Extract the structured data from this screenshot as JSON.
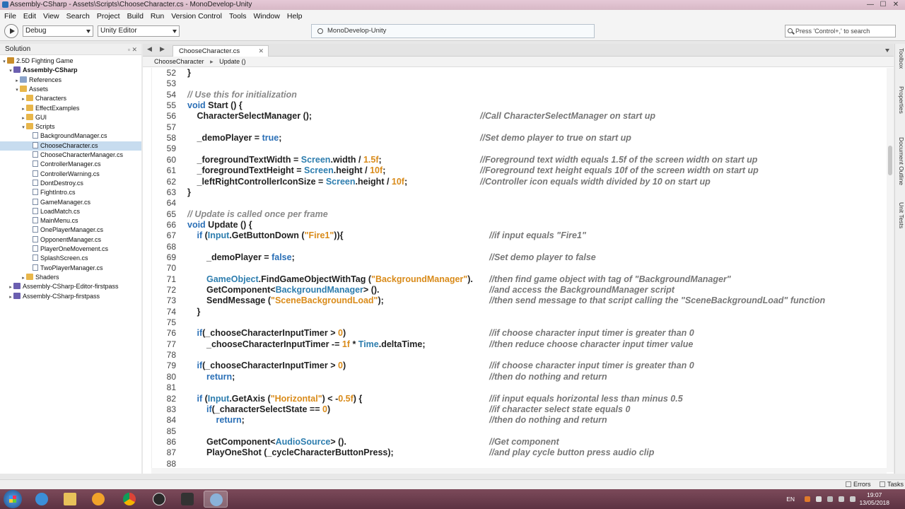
{
  "window": {
    "title": "Assembly-CSharp - Assets\\Scripts\\ChooseCharacter.cs - MonoDevelop-Unity",
    "controls": {
      "minimize": "—",
      "maximize": "☐",
      "close": "✕"
    }
  },
  "menu": [
    "File",
    "Edit",
    "View",
    "Search",
    "Project",
    "Build",
    "Run",
    "Version Control",
    "Tools",
    "Window",
    "Help"
  ],
  "toolbar": {
    "configuration": "Debug",
    "target": "Unity Editor",
    "status": "MonoDevelop-Unity",
    "search_placeholder": "Press 'Control+,' to search"
  },
  "solution_pad": {
    "title": "Solution",
    "buttons": "▫ ✕",
    "items": [
      {
        "label": "2.5D Fighting Game",
        "depth": 0,
        "icon": "sol",
        "arrow": "▾",
        "bold": false
      },
      {
        "label": "Assembly-CSharp",
        "depth": 1,
        "icon": "proj",
        "arrow": "▾",
        "bold": true
      },
      {
        "label": "References",
        "depth": 2,
        "icon": "refs",
        "arrow": "▸",
        "bold": false
      },
      {
        "label": "Assets",
        "depth": 2,
        "icon": "folder",
        "arrow": "▾",
        "bold": false
      },
      {
        "label": "Characters",
        "depth": 3,
        "icon": "folder",
        "arrow": "▸",
        "bold": false
      },
      {
        "label": "EffectExamples",
        "depth": 3,
        "icon": "folder",
        "arrow": "▸",
        "bold": false
      },
      {
        "label": "GUI",
        "depth": 3,
        "icon": "folder",
        "arrow": "▸",
        "bold": false
      },
      {
        "label": "Scripts",
        "depth": 3,
        "icon": "folder",
        "arrow": "▾",
        "bold": false
      },
      {
        "label": "BackgroundManager.cs",
        "depth": 4,
        "icon": "file",
        "arrow": "",
        "bold": false
      },
      {
        "label": "ChooseCharacter.cs",
        "depth": 4,
        "icon": "file",
        "arrow": "",
        "bold": false,
        "selected": true
      },
      {
        "label": "ChooseCharacterManager.cs",
        "depth": 4,
        "icon": "file",
        "arrow": "",
        "bold": false
      },
      {
        "label": "ControllerManager.cs",
        "depth": 4,
        "icon": "file",
        "arrow": "",
        "bold": false
      },
      {
        "label": "ControllerWarning.cs",
        "depth": 4,
        "icon": "file",
        "arrow": "",
        "bold": false
      },
      {
        "label": "DontDestroy.cs",
        "depth": 4,
        "icon": "file",
        "arrow": "",
        "bold": false
      },
      {
        "label": "FightIntro.cs",
        "depth": 4,
        "icon": "file",
        "arrow": "",
        "bold": false
      },
      {
        "label": "GameManager.cs",
        "depth": 4,
        "icon": "file",
        "arrow": "",
        "bold": false
      },
      {
        "label": "LoadMatch.cs",
        "depth": 4,
        "icon": "file",
        "arrow": "",
        "bold": false
      },
      {
        "label": "MainMenu.cs",
        "depth": 4,
        "icon": "file",
        "arrow": "",
        "bold": false
      },
      {
        "label": "OnePlayerManager.cs",
        "depth": 4,
        "icon": "file",
        "arrow": "",
        "bold": false
      },
      {
        "label": "OpponentManager.cs",
        "depth": 4,
        "icon": "file",
        "arrow": "",
        "bold": false
      },
      {
        "label": "PlayerOneMovement.cs",
        "depth": 4,
        "icon": "file",
        "arrow": "",
        "bold": false
      },
      {
        "label": "SplashScreen.cs",
        "depth": 4,
        "icon": "file",
        "arrow": "",
        "bold": false
      },
      {
        "label": "TwoPlayerManager.cs",
        "depth": 4,
        "icon": "file",
        "arrow": "",
        "bold": false
      },
      {
        "label": "Shaders",
        "depth": 3,
        "icon": "folder",
        "arrow": "▸",
        "bold": false
      },
      {
        "label": "Assembly-CSharp-Editor-firstpass",
        "depth": 1,
        "icon": "proj",
        "arrow": "▸",
        "bold": false
      },
      {
        "label": "Assembly-CSharp-firstpass",
        "depth": 1,
        "icon": "proj",
        "arrow": "▸",
        "bold": false
      }
    ]
  },
  "editor": {
    "tab": "ChooseCharacter.cs",
    "tab_close": "✕",
    "breadcrumb": [
      "ChooseCharacter",
      "Update ()"
    ],
    "lines": [
      {
        "n": "52",
        "indent": 0,
        "code": "}",
        "comment": ""
      },
      {
        "n": "53",
        "indent": 0,
        "code": "",
        "comment": ""
      },
      {
        "n": "54",
        "indent": 0,
        "code": "// Use this for initialization",
        "comment": "",
        "is_comment": true
      },
      {
        "n": "55",
        "indent": 0,
        "code": "void Start () {",
        "comment": ""
      },
      {
        "n": "56",
        "indent": 1,
        "code": "CharacterSelectManager ();",
        "comment": "//Call CharacterSelectManager on start up",
        "ccol": 414
      },
      {
        "n": "57",
        "indent": 0,
        "code": "",
        "comment": ""
      },
      {
        "n": "58",
        "indent": 1,
        "code": "_demoPlayer = true;",
        "comment": "//Set demo player to true on start up",
        "ccol": 414
      },
      {
        "n": "59",
        "indent": 0,
        "code": "",
        "comment": ""
      },
      {
        "n": "60",
        "indent": 1,
        "code": "_foregroundTextWidth = Screen.width / 1.5f;",
        "comment": "//Foreground text width equals 1.5f of the screen width on start up",
        "ccol": 414
      },
      {
        "n": "61",
        "indent": 1,
        "code": "_foregroundTextHeight = Screen.height / 10f;",
        "comment": "//Foreground text height equals 10f of the screen width on start up",
        "ccol": 414
      },
      {
        "n": "62",
        "indent": 1,
        "code": "_leftRightControllerIconSize = Screen.height / 10f;",
        "comment": "//Controller icon equals width divided by 10 on start up",
        "ccol": 414
      },
      {
        "n": "63",
        "indent": 0,
        "code": "}",
        "comment": ""
      },
      {
        "n": "64",
        "indent": 0,
        "code": "",
        "comment": ""
      },
      {
        "n": "65",
        "indent": 0,
        "code": "// Update is called once per frame",
        "comment": "",
        "is_comment": true
      },
      {
        "n": "66",
        "indent": 0,
        "code": "void Update () {",
        "comment": ""
      },
      {
        "n": "67",
        "indent": 1,
        "code": "if (Input.GetButtonDown (\"Fire1\")){",
        "comment": "//if input equals \"Fire1\"",
        "ccol": 427
      },
      {
        "n": "68",
        "indent": 0,
        "code": "",
        "comment": ""
      },
      {
        "n": "69",
        "indent": 2,
        "code": "_demoPlayer = false;",
        "comment": "//Set demo player to false",
        "ccol": 427
      },
      {
        "n": "70",
        "indent": 0,
        "code": "",
        "comment": ""
      },
      {
        "n": "71",
        "indent": 2,
        "code": "GameObject.FindGameObjectWithTag (\"BackgroundManager\").",
        "comment": "//then find game object with tag of \"BackgroundManager\"",
        "ccol": 427
      },
      {
        "n": "72",
        "indent": 2,
        "code": "GetComponent<BackgroundManager> ().",
        "comment": "//and access the BackgroundManager script",
        "ccol": 427
      },
      {
        "n": "73",
        "indent": 2,
        "code": "SendMessage (\"SceneBackgroundLoad\");",
        "comment": "//then send message to that script calling the \"SceneBackgroundLoad\" function",
        "ccol": 427
      },
      {
        "n": "74",
        "indent": 1,
        "code": "}",
        "comment": ""
      },
      {
        "n": "75",
        "indent": 0,
        "code": "",
        "comment": ""
      },
      {
        "n": "76",
        "indent": 1,
        "code": "if(_chooseCharacterInputTimer > 0)",
        "comment": "//if choose character input timer is greater than 0",
        "ccol": 427
      },
      {
        "n": "77",
        "indent": 2,
        "code": "_chooseCharacterInputTimer -= 1f * Time.deltaTime;",
        "comment": "//then reduce choose character input timer value",
        "ccol": 427
      },
      {
        "n": "78",
        "indent": 0,
        "code": "",
        "comment": ""
      },
      {
        "n": "79",
        "indent": 1,
        "code": "if(_chooseCharacterInputTimer > 0)",
        "comment": "//if choose character input timer is greater than 0",
        "ccol": 427
      },
      {
        "n": "80",
        "indent": 2,
        "code": "return;",
        "comment": "//then do nothing and return",
        "ccol": 427
      },
      {
        "n": "81",
        "indent": 0,
        "code": "",
        "comment": ""
      },
      {
        "n": "82",
        "indent": 1,
        "code": "if (Input.GetAxis (\"Horizontal\") < -0.5f) {",
        "comment": "//if input equals horizontal less than minus 0.5",
        "ccol": 427
      },
      {
        "n": "83",
        "indent": 2,
        "code": "if(_characterSelectState == 0)",
        "comment": "//if character select state equals 0",
        "ccol": 427
      },
      {
        "n": "84",
        "indent": 3,
        "code": "return;",
        "comment": "//then do nothing and return",
        "ccol": 427
      },
      {
        "n": "85",
        "indent": 0,
        "code": "",
        "comment": ""
      },
      {
        "n": "86",
        "indent": 2,
        "code": "GetComponent<AudioSource> ().",
        "comment": "//Get component",
        "ccol": 427
      },
      {
        "n": "87",
        "indent": 2,
        "code": "PlayOneShot (_cycleCharacterButtonPress);",
        "comment": "//and play cycle button press audio clip",
        "ccol": 427
      },
      {
        "n": "88",
        "indent": 0,
        "code": "",
        "comment": ""
      }
    ]
  },
  "side_pads": [
    "Toolbox",
    "Properties",
    "Document Outline",
    "Unit Tests"
  ],
  "statusbar": {
    "errors": "Errors",
    "tasks": "Tasks"
  },
  "taskbar": {
    "apps": [
      "internet-explorer-icon",
      "file-explorer-icon",
      "media-player-icon",
      "chrome-icon",
      "obs-icon",
      "unity-icon",
      "monodevelop-icon"
    ],
    "language": "EN",
    "time": "19:07",
    "date": "13/05/2018"
  }
}
